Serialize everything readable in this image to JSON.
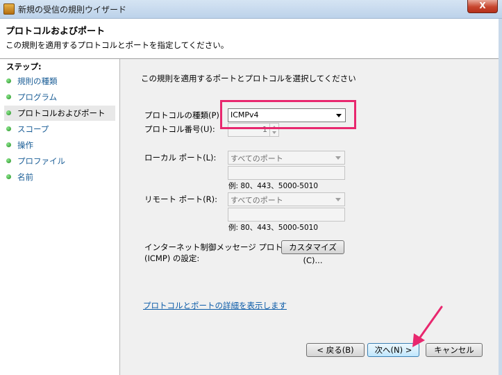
{
  "window": {
    "title": "新規の受信の規則ウイザード",
    "close_label": "X"
  },
  "header": {
    "title": "プロトコルおよびポート",
    "description": "この規則を適用するプロトコルとポートを指定してください。"
  },
  "sidebar": {
    "steps_label": "ステップ:",
    "items": [
      {
        "label": "規則の種類"
      },
      {
        "label": "プログラム"
      },
      {
        "label": "プロトコルおよびポート"
      },
      {
        "label": "スコープ"
      },
      {
        "label": "操作"
      },
      {
        "label": "プロファイル"
      },
      {
        "label": "名前"
      }
    ],
    "active_index": 2
  },
  "main": {
    "instruction": "この規則を適用するポートとプロトコルを選択してください",
    "protocol_type_label": "プロトコルの種類(P):",
    "protocol_type_value": "ICMPv4",
    "protocol_number_label": "プロトコル番号(U):",
    "protocol_number_value": "1",
    "local_port_label": "ローカル ポート(L):",
    "local_port_value": "すべてのポート",
    "local_port_example": "例: 80、443、5000-5010",
    "remote_port_label": "リモート ポート(R):",
    "remote_port_value": "すべてのポート",
    "remote_port_example": "例: 80、443、5000-5010",
    "icmp_label_line1": "インターネット制御メッセージ プロトコル",
    "icmp_label_line2": "(ICMP) の設定:",
    "customize_label": "カスタマイズ(C)...",
    "details_link": "プロトコルとポートの詳細を表示します"
  },
  "footer": {
    "back_label": "< 戻る(B)",
    "next_label": "次へ(N) >",
    "cancel_label": "キャンセル"
  },
  "colors": {
    "highlight": "#e8276e",
    "link": "#0b5ba8",
    "step_link": "#1a5d96"
  }
}
